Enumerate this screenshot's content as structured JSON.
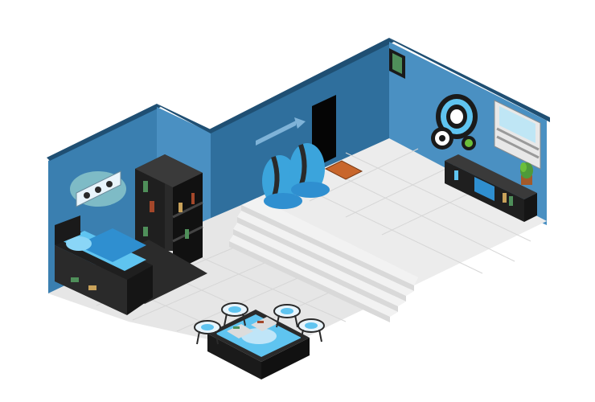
{
  "room": {
    "palette": {
      "wall_light": "#4a90c2",
      "wall_mid": "#3a7fb0",
      "wall_dark": "#2f6f9d",
      "wall_top": "#1f4f73",
      "floor_tile": "#ececec",
      "floor_grout": "#d6d6d6",
      "stair_face": "#d9d9d9",
      "stair_top": "#f2f2f2",
      "accent_cyan": "#5fc4f0",
      "furniture_black": "#2a2a2a",
      "door": "#050505",
      "rug": "#2b2b2b"
    }
  },
  "furniture": [
    {
      "name": "wall-lamp-decal-icon"
    },
    {
      "name": "bookshelf-icon"
    },
    {
      "name": "bed-icon"
    },
    {
      "name": "bean-bag-left-icon"
    },
    {
      "name": "bean-bag-right-icon"
    },
    {
      "name": "doormat-icon"
    },
    {
      "name": "arrow-sign-icon"
    },
    {
      "name": "target-poster-icon"
    },
    {
      "name": "tv-cabinet-icon"
    },
    {
      "name": "potted-plant-icon"
    },
    {
      "name": "coffee-table-icon"
    },
    {
      "name": "stool-icon"
    }
  ]
}
